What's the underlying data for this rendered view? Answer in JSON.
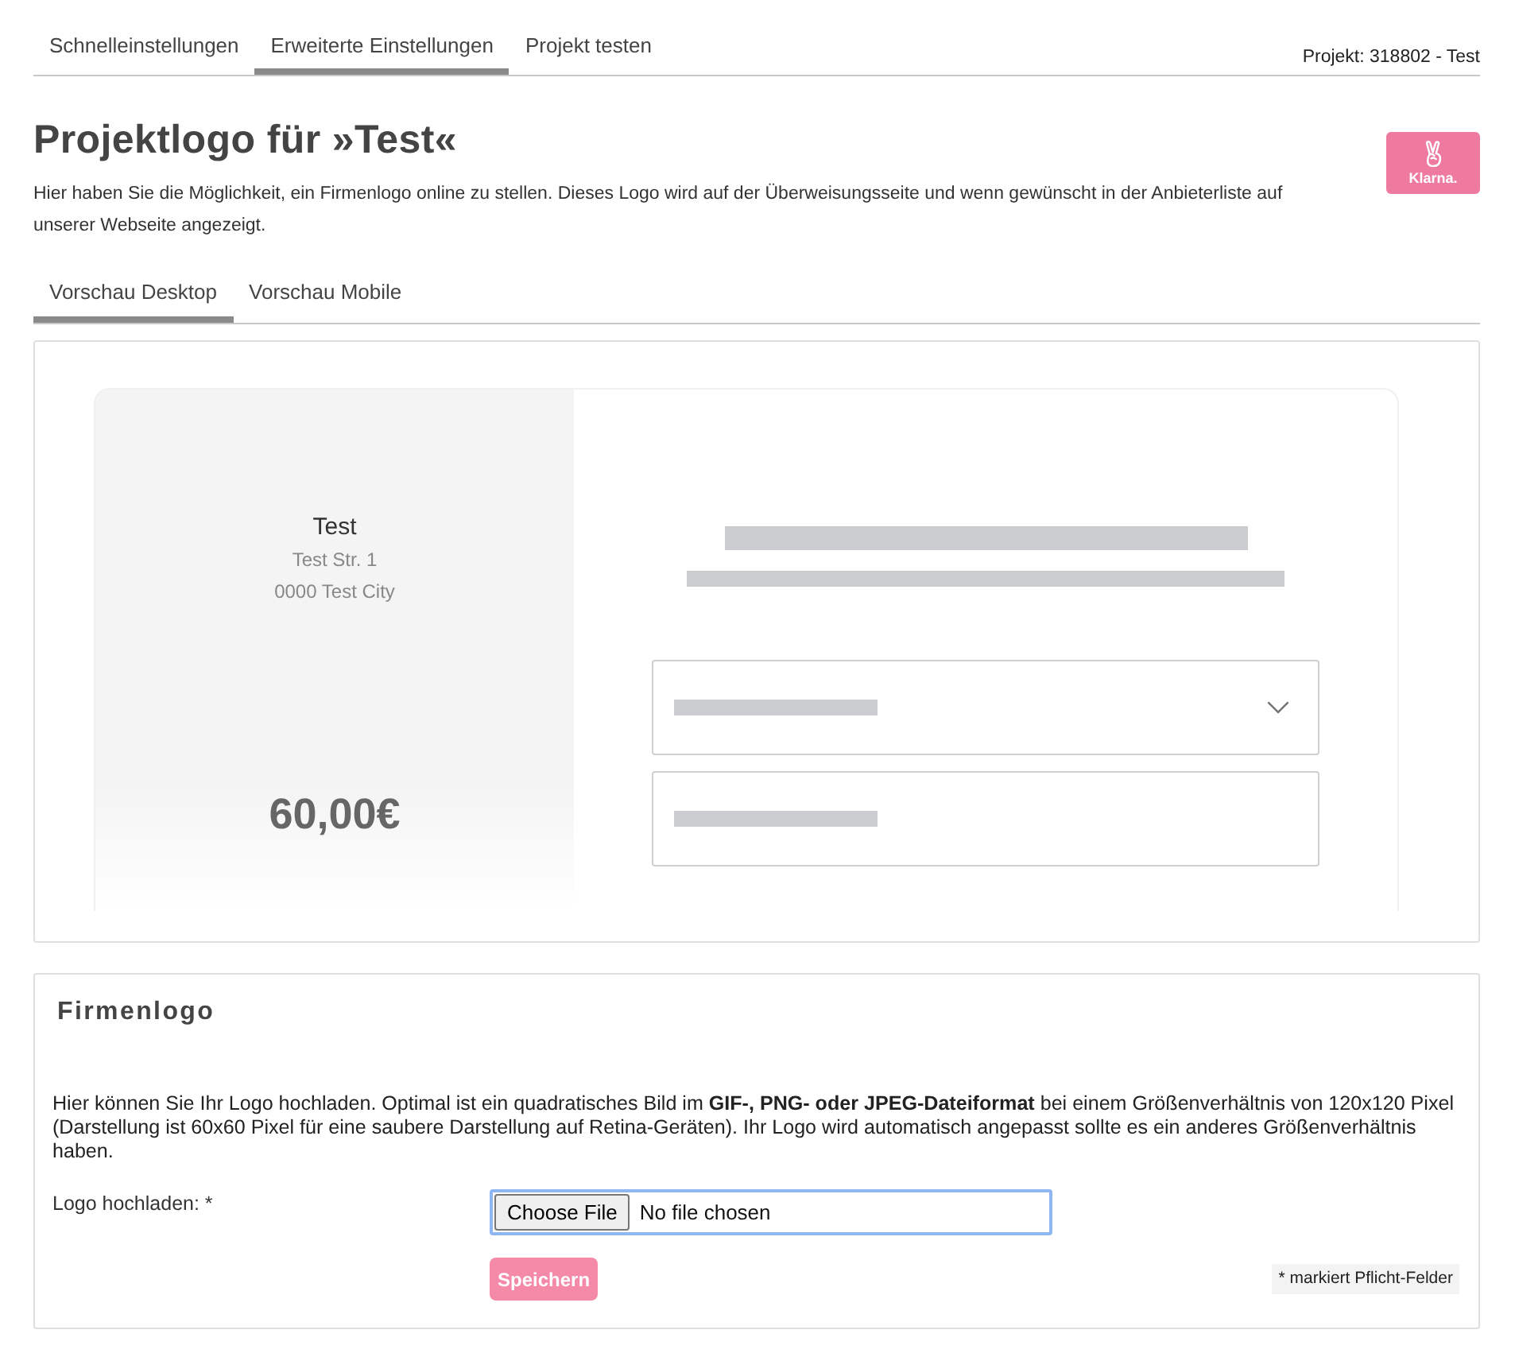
{
  "top_tabs": [
    {
      "label": "Schnelleinstellungen",
      "selected": false
    },
    {
      "label": "Erweiterte Einstellungen",
      "selected": true
    },
    {
      "label": "Projekt testen",
      "selected": false
    }
  ],
  "project_label": "Projekt: 318802 - Test",
  "header": {
    "title": "Projektlogo für »Test«",
    "description": "Hier haben Sie die Möglichkeit, ein Firmenlogo online zu stellen. Dieses Logo wird auf der Überweisungsseite und wenn gewünscht in der Anbieterliste auf unserer Webseite angezeigt.",
    "logo_text": "Klarna."
  },
  "preview_tabs": [
    {
      "label": "Vorschau Desktop",
      "selected": true
    },
    {
      "label": "Vorschau Mobile",
      "selected": false
    }
  ],
  "preview": {
    "merchant_name": "Test",
    "street": "Test Str. 1",
    "city": "0000 Test City",
    "amount": "60,00€",
    "fields": [
      {
        "kind": "select"
      },
      {
        "kind": "input"
      }
    ]
  },
  "logo_section": {
    "title": "Firmenlogo",
    "description": "Hier können Sie Ihr Logo hochladen. Optimal ist ein quadratisches Bild im **GIF-, PNG- oder JPEG-Dateiformat** bei einem Größenverhältnis von 120x120 Pixel (Darstellung ist 60x60 Pixel für eine saubere Darstellung auf Retina-Geräten). Ihr Logo wird automatisch angepasst sollte es ein anderes Größenverhältnis haben.",
    "upload_label": "Logo hochladen: *",
    "file_button": "Choose File",
    "file_status": "No file chosen",
    "save_button": "Speichern",
    "required_note": "* markiert Pflicht-Felder"
  }
}
